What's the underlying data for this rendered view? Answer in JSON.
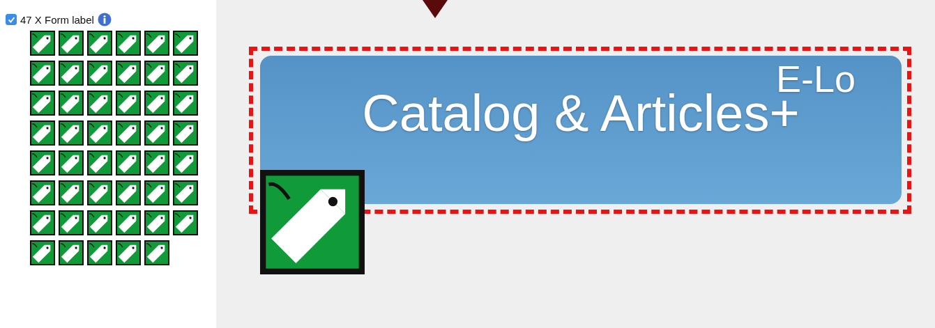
{
  "sidebar": {
    "checkbox": {
      "label": "47 X Form label",
      "checked": true
    }
  },
  "canvas": {
    "button": {
      "label": "Catalog & Articles+",
      "selected": true
    },
    "cut_text": "E-Lo"
  }
}
